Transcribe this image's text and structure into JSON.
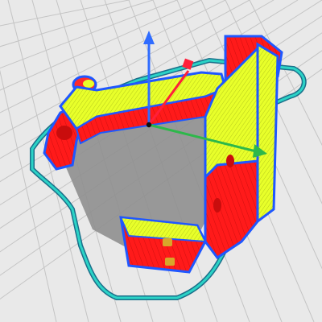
{
  "viewport": {
    "view_mode": "layer-preview",
    "show_build_plate_grid": true,
    "show_skirt": true,
    "show_gizmo": true
  },
  "colors": {
    "background": "#e9e9e9",
    "grid_line": "#c4c4c4",
    "shadow": "#8f8f8f",
    "skirt": "#2bd3c6",
    "skirt_outline": "#1a6f8a",
    "wall_outer": "#1f57ff",
    "wall_inner": "#ff1a1a",
    "infill": "#e8ff2a",
    "top_surface": "#d4e81e",
    "axis_x": "#2db84a",
    "axis_y": "#2f6cff",
    "axis_z": "#ff1f3a"
  },
  "gizmo": {
    "axes": [
      "x-axis",
      "y-axis",
      "z-axis"
    ],
    "icons": {
      "x": "arrow-right-icon",
      "y": "arrow-up-icon",
      "z": "cube-handle-icon"
    }
  }
}
